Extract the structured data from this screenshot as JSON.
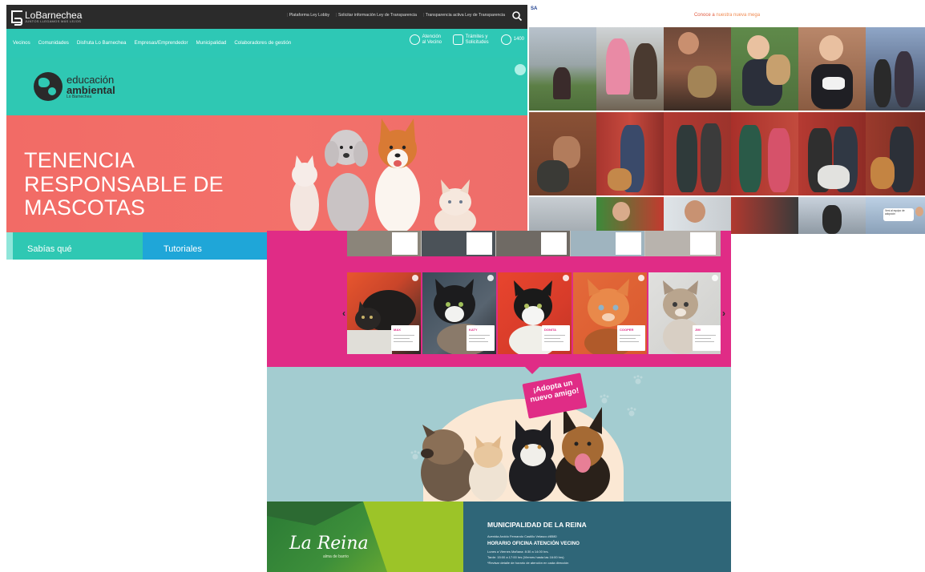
{
  "lobarnechea": {
    "logo_text": "LoBarnechea",
    "logo_sub": "JUNTOS LLEGAMOS MÁS LEJOS",
    "top_links": [
      "Plataforma Ley Lobby",
      "Solicitar información Ley de Transparencia",
      "Transparencia activa Ley de Transparencia"
    ],
    "nav_items": [
      "Vecinos",
      "Comunidades",
      "Disfruta Lo Barnechea",
      "Empresas/Emprendedor",
      "Municipalidad",
      "Colaboradores de gestión"
    ],
    "nav_right": [
      {
        "label": "Atención al Vecino",
        "icon": "chat-icon"
      },
      {
        "label": "Trámites y Solicitudes",
        "icon": "document-icon"
      },
      {
        "label": "1400",
        "icon": "phone-icon"
      }
    ],
    "edu_logo": {
      "l1": "educación",
      "l2": "ambiental",
      "l3": "Lo Barnechea"
    },
    "banner_title": "TENENCIA RESPONSABLE DE MASCOTAS",
    "tabs": [
      "Sabías qué",
      "Tutoriales"
    ],
    "colors": {
      "topbar": "#2b2b2b",
      "teal": "#2ec8b5",
      "banner": "#f26b66",
      "tab_blue": "#1fa6d8"
    }
  },
  "photo_grid": {
    "logo": "SA",
    "heading_prefix": "Conoce a ",
    "heading_link": "nuestra nueva mega",
    "bubble_text": "Vení al equipo de adopción"
  },
  "lareina": {
    "cats": [
      {
        "name": "MAX"
      },
      {
        "name": "KATY"
      },
      {
        "name": "DONITA"
      },
      {
        "name": "COOPER"
      },
      {
        "name": "JIM"
      }
    ],
    "sign_text": "¡Adopta un nuevo amigo!",
    "brand": "La Reina",
    "brand_sub": "alma de barrio",
    "municipalidad": "MUNICIPALIDAD DE LA REINA",
    "address": "Avenida Aroldo Fernando Castillo Velasco #8580",
    "horario_title": "HORARIO OFICINA ATENCIÓN VECINO",
    "horario_lines": [
      "Lunes a Viernes Mañana: 8:30 a 14:00 hrs.",
      "Tarde: 15:00 a 17:00 hrs (Viernes hasta las 16:00 hrs)",
      "*Revisar detalle de horario de atención en cada dirección"
    ],
    "colors": {
      "pink": "#e02c86",
      "teal": "#a3ccd0",
      "footer_blue": "#2f6678",
      "footer_green": "#3d8f3a"
    }
  }
}
